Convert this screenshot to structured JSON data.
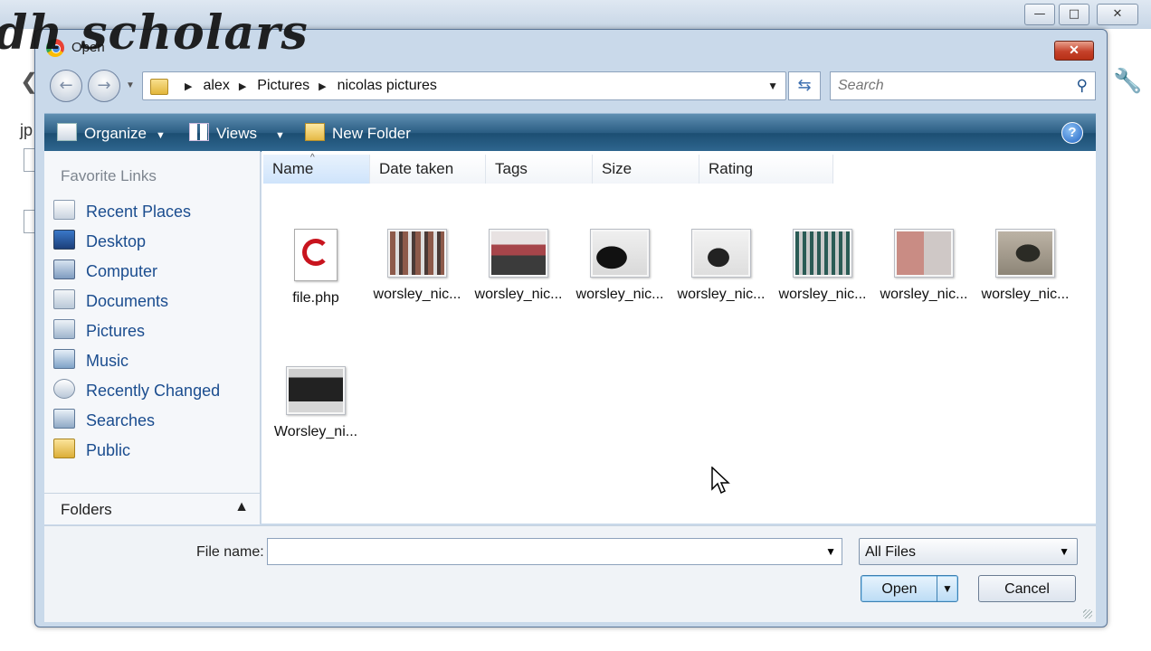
{
  "background": {
    "watermark": "dh scholars",
    "left_text": "jp"
  },
  "dialog": {
    "title": "Open",
    "close_label": "✕",
    "address": {
      "crumbs": [
        "alex",
        "Pictures",
        "nicolas pictures"
      ]
    },
    "search_placeholder": "Search",
    "toolbar": {
      "organize": "Organize",
      "views": "Views",
      "new_folder": "New Folder",
      "help": "?"
    },
    "nav": {
      "favorites_heading": "Favorite Links",
      "items": [
        {
          "label": "Recent Places",
          "icon": "recent-places-icon"
        },
        {
          "label": "Desktop",
          "icon": "desktop-icon"
        },
        {
          "label": "Computer",
          "icon": "computer-icon"
        },
        {
          "label": "Documents",
          "icon": "documents-icon"
        },
        {
          "label": "Pictures",
          "icon": "pictures-icon"
        },
        {
          "label": "Music",
          "icon": "music-icon"
        },
        {
          "label": "Recently Changed",
          "icon": "recently-changed-icon"
        },
        {
          "label": "Searches",
          "icon": "searches-icon"
        },
        {
          "label": "Public",
          "icon": "public-folder-icon"
        }
      ],
      "folders_label": "Folders"
    },
    "columns": [
      "Name",
      "Date taken",
      "Tags",
      "Size",
      "Rating"
    ],
    "files": [
      {
        "name": "file.php",
        "type": "php"
      },
      {
        "name": "worsley_nic...",
        "type": "image"
      },
      {
        "name": "worsley_nic...",
        "type": "image"
      },
      {
        "name": "worsley_nic...",
        "type": "image"
      },
      {
        "name": "worsley_nic...",
        "type": "image"
      },
      {
        "name": "worsley_nic...",
        "type": "image"
      },
      {
        "name": "worsley_nic...",
        "type": "image"
      },
      {
        "name": "worsley_nic...",
        "type": "image"
      },
      {
        "name": "Worsley_ni...",
        "type": "image"
      }
    ],
    "bottom": {
      "file_name_label": "File name:",
      "file_name_value": "",
      "filter_value": "All Files",
      "open_label": "Open",
      "cancel_label": "Cancel"
    }
  }
}
